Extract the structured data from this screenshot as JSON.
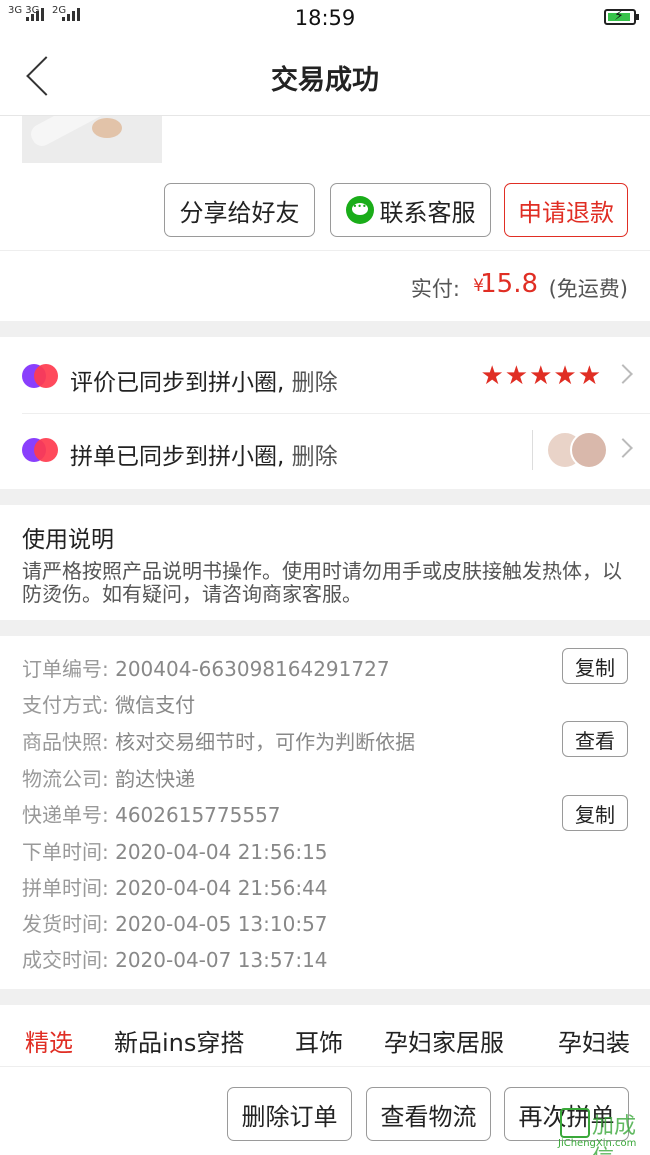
{
  "status_bar": {
    "signal_left": "3G 3G",
    "signal_right": "2G",
    "time": "18:59"
  },
  "nav": {
    "title": "交易成功"
  },
  "actions": {
    "share": "分享给好友",
    "service": "联系客服",
    "refund": "申请退款"
  },
  "payment": {
    "label": "实付:",
    "currency": "¥",
    "amount": "15.8",
    "note": "(免运费)"
  },
  "sync": [
    {
      "text": "评价已同步到拼小圈,",
      "delete": "删除",
      "stars": "★★★★★"
    },
    {
      "text": "拼单已同步到拼小圈,",
      "delete": "删除"
    }
  ],
  "usage": {
    "title": "使用说明",
    "body": "请严格按照产品说明书操作。使用时请勿用手或皮肤接触发热体，以防烫伤。如有疑问，请咨询商家客服。"
  },
  "order_info": {
    "order_no_label": "订单编号:",
    "order_no": "200404-663098164291727",
    "copy_label": "复制",
    "pay_label": "支付方式:",
    "pay_value": "微信支付",
    "snapshot_label": "商品快照:",
    "snapshot_value": "核对交易细节时，可作为判断依据",
    "view_label": "查看",
    "logistics_label": "物流公司:",
    "logistics_value": "韵达快递",
    "tracking_label": "快递单号:",
    "tracking_value": "4602615775557",
    "copy2_label": "复制",
    "order_time_label": "下单时间:",
    "order_time": "2020-04-04 21:56:15",
    "group_time_label": "拼单时间:",
    "group_time": "2020-04-04 21:56:44",
    "ship_time_label": "发货时间:",
    "ship_time": "2020-04-05 13:10:57",
    "deal_time_label": "成交时间:",
    "deal_time": "2020-04-07 13:57:14"
  },
  "tabs": [
    "精选",
    "新品ins穿搭",
    "耳饰",
    "孕妇家居服",
    "孕妇装"
  ],
  "bottom": {
    "delete_order": "删除订单",
    "view_logistics": "查看物流",
    "regroup": "再次拼单"
  },
  "watermark": {
    "text": "加成信",
    "sub": "JiChengXin.com"
  },
  "colors": {
    "accent": "#e02e24",
    "wechat": "#1aad19",
    "pdd_purple": "#8a3ffc"
  }
}
